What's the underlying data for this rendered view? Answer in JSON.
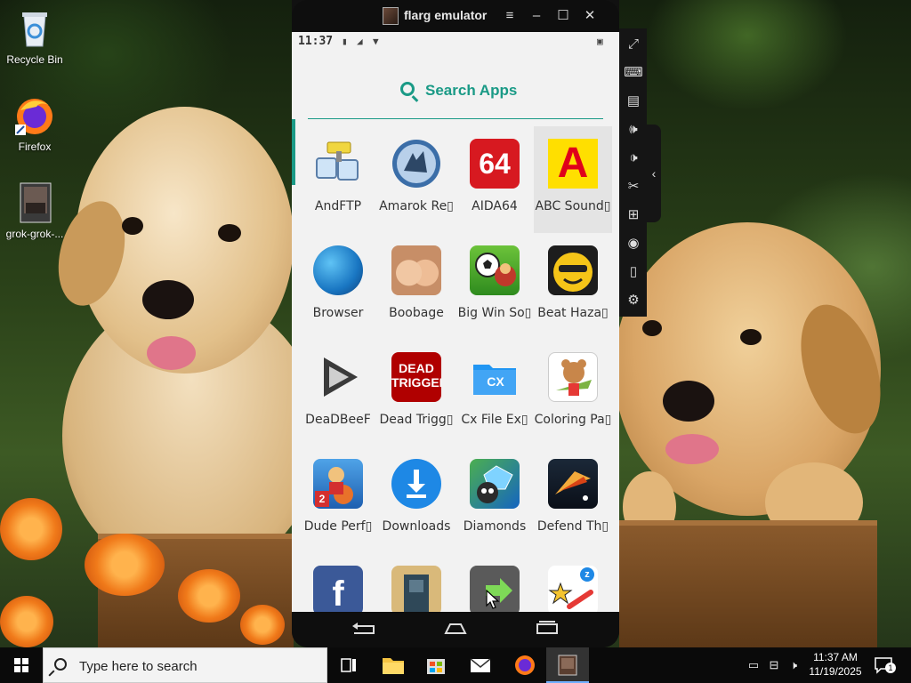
{
  "desktop": {
    "icons": [
      {
        "label": "Recycle Bin",
        "icon": "recycle-bin-icon"
      },
      {
        "label": "Firefox",
        "icon": "firefox-icon"
      },
      {
        "label": "grok-grok-...",
        "icon": "image-file-icon"
      }
    ]
  },
  "emulator": {
    "title": "flarg emulator",
    "status": {
      "time": "11:37"
    },
    "search_label": "Search Apps",
    "apps": [
      {
        "name": "AndFTP"
      },
      {
        "name": "Amarok Re▯"
      },
      {
        "name": "AIDA64",
        "icon_text": "64"
      },
      {
        "name": "ABC Sound▯",
        "icon_text": "A"
      },
      {
        "name": "Browser"
      },
      {
        "name": "Boobage"
      },
      {
        "name": "Big Win So▯"
      },
      {
        "name": "Beat Haza▯"
      },
      {
        "name": "DeaDBeeF"
      },
      {
        "name": "Dead Trigg▯",
        "icon_text": "DEAD TRIGGER"
      },
      {
        "name": "Cx File Ex▯",
        "icon_text": "CX"
      },
      {
        "name": "Coloring Pa▯"
      },
      {
        "name": "Dude Perf▯",
        "icon_text": "2"
      },
      {
        "name": "Downloads"
      },
      {
        "name": "Diamonds"
      },
      {
        "name": "Defend Th▯"
      },
      {
        "name": "",
        "icon_text": "f"
      },
      {
        "name": ""
      },
      {
        "name": ""
      },
      {
        "name": "",
        "icon_text": "z"
      }
    ],
    "selected_app": "ABC Sound▯",
    "colors": {
      "accent": "#1a9a86",
      "screen_bg": "#f2f2f2",
      "frame": "#111111"
    }
  },
  "taskbar": {
    "search_placeholder": "Type here to search",
    "clock": {
      "time": "11:37 AM",
      "date": "11/19/2025"
    },
    "notification_count": "1"
  }
}
